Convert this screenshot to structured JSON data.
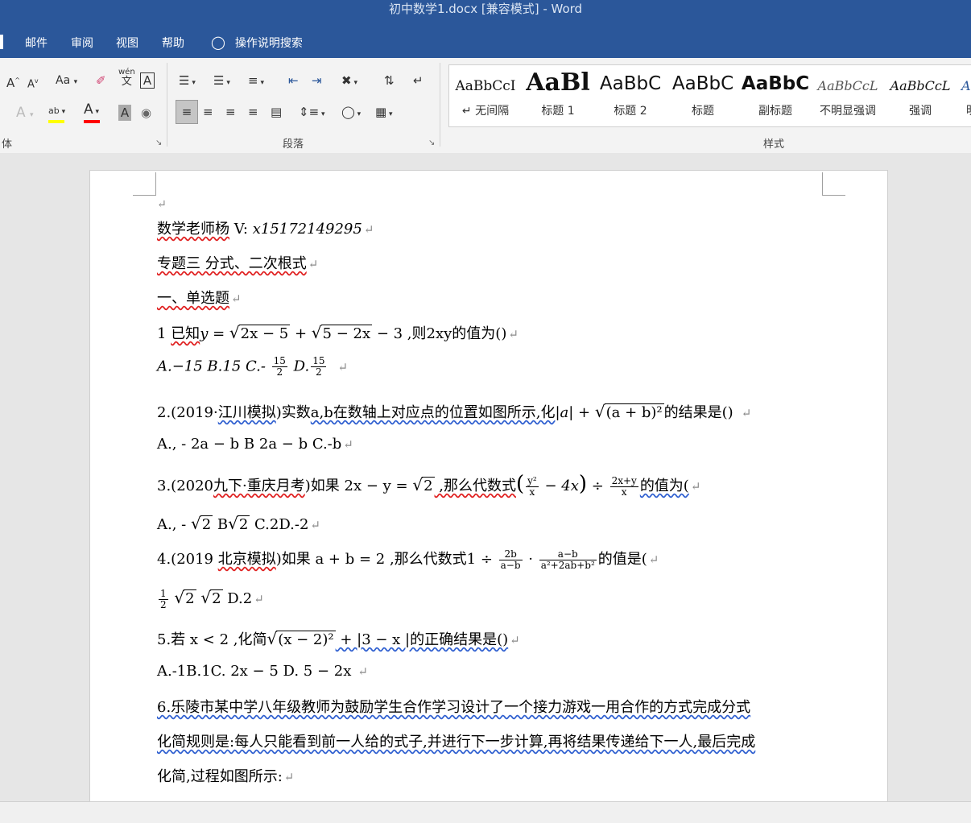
{
  "window": {
    "title": "初中数学1.docx [兼容模式]  -  Word"
  },
  "tabs": [
    {
      "label": "邮件"
    },
    {
      "label": "审阅"
    },
    {
      "label": "视图"
    },
    {
      "label": "帮助"
    },
    {
      "label": "操作说明搜索"
    }
  ],
  "ribbon": {
    "font_group_label": "体",
    "paragraph_group_label": "段落",
    "styles_group_label": "样式",
    "case_label": "Aa",
    "phonetic_top": "wén",
    "phonetic_bottom": "文",
    "highlight_color": "#ffff00",
    "font_color": "#ff0000",
    "styles": [
      {
        "sample": "AaBbCcI",
        "name": "↵ 无间隔"
      },
      {
        "sample": "AaBl",
        "name": "标题 1"
      },
      {
        "sample": "AaBbC",
        "name": "标题 2"
      },
      {
        "sample": "AaBbC",
        "name": "标题"
      },
      {
        "sample": "AaBbC",
        "name": "副标题"
      },
      {
        "sample": "AaBbCcL",
        "name": "不明显强调"
      },
      {
        "sample": "AaBbCcL",
        "name": "强调"
      },
      {
        "sample": "A",
        "name": "明"
      }
    ]
  },
  "doc": {
    "l1": "数学老师杨",
    "l1b": " V: ",
    "l1c": "x15172149295",
    "l2": "专题三 分式、二次根式",
    "l3": "一、单选题",
    "q1a": "1",
    "q1b": "已知",
    "q1c": "y = ",
    "q1r1": "2x − 5",
    "q1d": " + ",
    "q1r2": "5 − 2x",
    "q1e": " − 3  ,则2xy的值为()",
    "q1o1": "A.−15  B.15 C.- ",
    "q1f1n": "15",
    "q1f1d": "2",
    "q1o2": "  D.",
    "q1f2n": "15",
    "q1f2d": "2",
    "q2a": "2.(2019·",
    "q2b": "江川模拟",
    "q2c": ")实数",
    "q2d": "a,b在数轴上对应点的位置如图所示,化",
    "q2e": "|a| + ",
    "q2r": "(a + b)²",
    "q2f": "的结果是()",
    "q2o": "A., - 2a − b  B 2a − b C.-b",
    "q3a": "3.(2020",
    "q3b": "九下·重庆月考",
    "q3c": ")如果 2x − y = ",
    "q3r": "2",
    "q3d": "  ,那么代数式",
    "q3fn": "y²",
    "q3fd": "x",
    "q3e": " − 4x",
    "q3f": " ÷ ",
    "q3gn": "2x+y",
    "q3gd": "x",
    "q3h": "的值为(",
    "q3o1": "A., - ",
    "q3or1": "2",
    "q3o2": "  B",
    "q3or2": "2",
    "q3o3": "  C.2D.-2",
    "q4a": "4.(2019 ",
    "q4b": "北京模拟",
    "q4c": ")如果 a + b = 2  ,那么代数式1 ÷ ",
    "q4f1n": "2b",
    "q4f1d": "a−b",
    "q4d": " · ",
    "q4f2n": "a−b",
    "q4f2d": "a²+2ab+b²",
    "q4e": "的值是(",
    "q4on": "1",
    "q4od": "2",
    "q4or1": "2",
    "q4or2": "2",
    "q4o": "  D.2",
    "q5a": "5.若 x < 2  ,化简",
    "q5r": "(x − 2)²",
    "q5b": " + |3 − x  |的正确结果是()",
    "q5o": "A.-1B.1C. 2x − 5 D. 5 − 2x",
    "q6a": "6.乐陵市某中学八年级教师为鼓励学生合作学习设计了一个接力游戏一用合作的方式完成分式",
    "q6b": "化简规则是:每人只能看到前一人给的式子,并进行下一步计算,再将结果传递给下一人,最后完成",
    "q6c": "化简,过程如图所示:",
    "mark": "↵"
  }
}
